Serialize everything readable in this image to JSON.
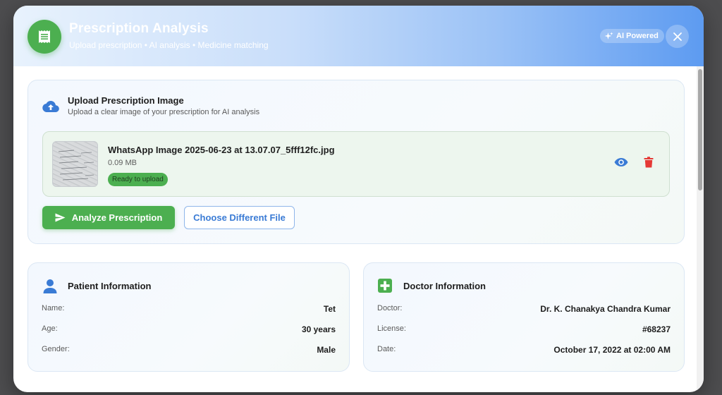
{
  "header": {
    "title": "Prescription Analysis",
    "subtitle": "Upload prescription • AI analysis • Medicine matching",
    "ai_badge": "AI Powered"
  },
  "upload": {
    "title": "Upload Prescription Image",
    "subtitle": "Upload a clear image of your prescription for AI analysis",
    "file": {
      "name": "WhatsApp Image 2025-06-23 at 13.07.07_5fff12fc.jpg",
      "size": "0.09 MB",
      "status": "Ready to upload"
    },
    "analyze_label": "Analyze Prescription",
    "choose_label": "Choose Different File"
  },
  "patient": {
    "title": "Patient Information",
    "rows": [
      {
        "label": "Name:",
        "value": "Tet"
      },
      {
        "label": "Age:",
        "value": "30 years"
      },
      {
        "label": "Gender:",
        "value": "Male"
      }
    ]
  },
  "doctor": {
    "title": "Doctor Information",
    "rows": [
      {
        "label": "Doctor:",
        "value": "Dr. K. Chanakya Chandra Kumar"
      },
      {
        "label": "License:",
        "value": "#68237"
      },
      {
        "label": "Date:",
        "value": "October 17, 2022 at 02:00 AM"
      }
    ]
  },
  "colors": {
    "accent_green": "#4caf50",
    "accent_blue": "#3a7bd5",
    "danger_red": "#e53935"
  },
  "icons": {
    "header": "prescription-icon",
    "badge": "sparkle-icon",
    "close": "close-icon",
    "upload": "cloud-upload-icon",
    "view": "eye-icon",
    "delete": "trash-icon",
    "analyze": "send-icon",
    "patient": "person-icon",
    "doctor": "medical-cross-icon"
  }
}
